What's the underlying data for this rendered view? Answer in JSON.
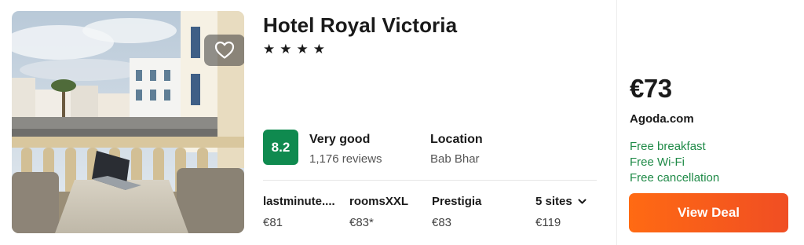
{
  "hotel": {
    "name": "Hotel Royal Victoria",
    "stars_text": "★★★★",
    "stars_count": 4
  },
  "rating": {
    "score": "8.2",
    "label": "Very good",
    "reviews": "1,176 reviews"
  },
  "location": {
    "label": "Location",
    "value": "Bab Bhar"
  },
  "sites": [
    {
      "name": "lastminute....",
      "price": "€81"
    },
    {
      "name": "roomsXXL",
      "price": "€83*"
    },
    {
      "name": "Prestigia",
      "price": "€83"
    },
    {
      "name": "5 sites",
      "price": "€119"
    }
  ],
  "deal": {
    "price": "€73",
    "provider": "Agoda.com",
    "perks": [
      "Free breakfast",
      "Free Wi-Fi",
      "Free cancellation"
    ],
    "button_label": "View Deal"
  },
  "icons": {
    "favorite": "heart-icon",
    "more_sites": "chevron-down-icon"
  },
  "colors": {
    "score_bg": "#0f8a4f",
    "perk_text": "#1f8a47",
    "deal_button": "#f25a1c"
  }
}
